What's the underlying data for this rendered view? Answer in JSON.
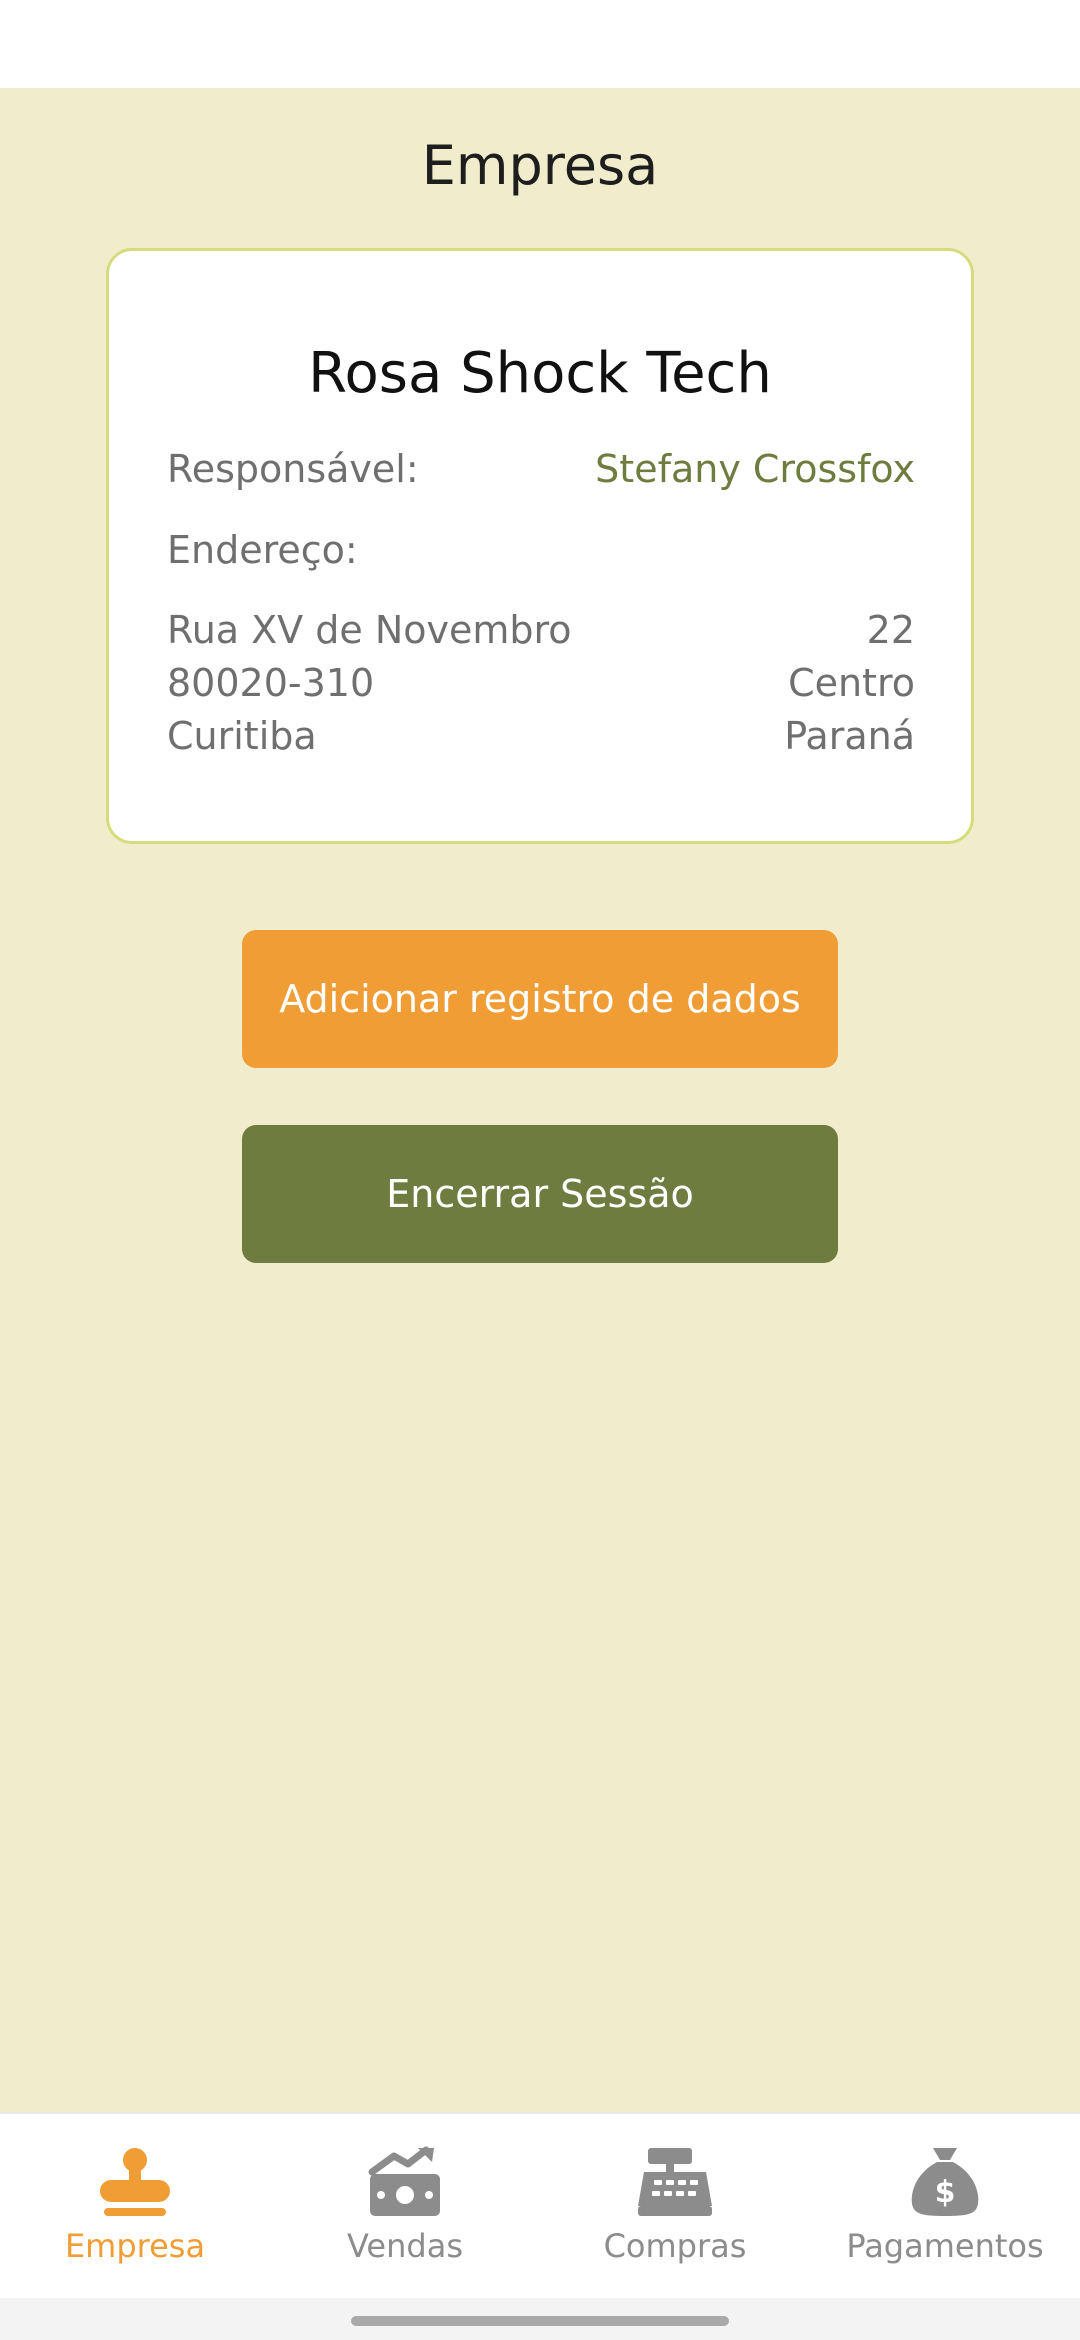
{
  "header": {
    "title": "Empresa"
  },
  "company": {
    "name": "Rosa Shock Tech",
    "responsible_label": "Responsável:",
    "responsible_name": "Stefany Crossfox",
    "address_label": "Endereço:",
    "street": "Rua XV de Novembro",
    "number": "22",
    "zip": "80020-310",
    "district": "Centro",
    "city": "Curitiba",
    "state": "Paraná"
  },
  "actions": {
    "add_label": "Adicionar registro de dados",
    "logout_label": "Encerrar Sessão"
  },
  "tabs": [
    {
      "label": "Empresa",
      "icon": "stamp-icon",
      "active": true
    },
    {
      "label": "Vendas",
      "icon": "money-trend-icon",
      "active": false
    },
    {
      "label": "Compras",
      "icon": "cash-register-icon",
      "active": false
    },
    {
      "label": "Pagamentos",
      "icon": "money-bag-icon",
      "active": false
    }
  ],
  "colors": {
    "background": "#f1edcc",
    "accent_orange": "#f09d36",
    "accent_olive": "#6f7c40",
    "card_border": "#d6dc7d",
    "inactive_gray": "#8c8c8c"
  }
}
